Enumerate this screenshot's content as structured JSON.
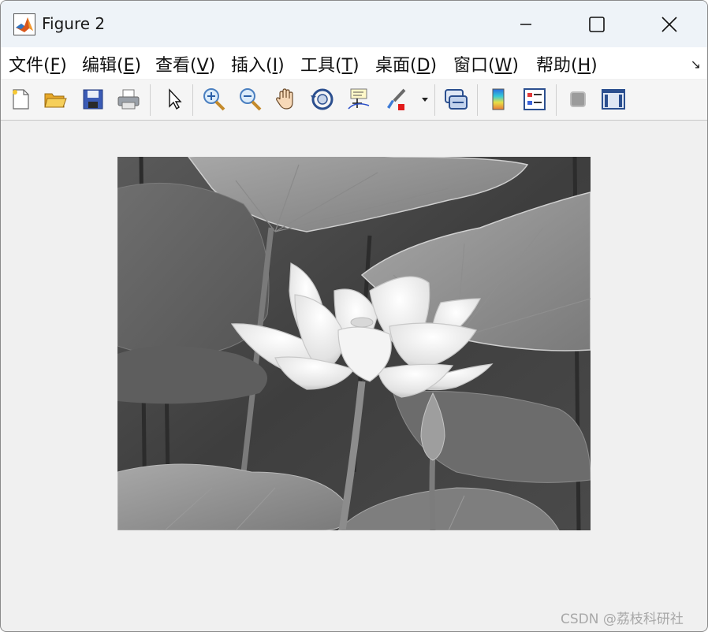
{
  "window": {
    "title": "Figure 2",
    "app_icon": "matlab-logo-icon"
  },
  "menubar": {
    "items": [
      {
        "label": "文件(",
        "key": "F",
        "end": ")"
      },
      {
        "label": "编辑(",
        "key": "E",
        "end": ")"
      },
      {
        "label": "查看(",
        "key": "V",
        "end": ")"
      },
      {
        "label": "插入(",
        "key": "I",
        "end": ")"
      },
      {
        "label": "工具(",
        "key": "T",
        "end": ")"
      },
      {
        "label": "桌面(",
        "key": "D",
        "end": ")"
      },
      {
        "label": "窗口(",
        "key": "W",
        "end": ")"
      },
      {
        "label": "帮助(",
        "key": "H",
        "end": ")"
      }
    ],
    "dock_icon": "dock-arrow-icon"
  },
  "toolbar": {
    "icons": [
      "new-figure-icon",
      "open-file-icon",
      "save-icon",
      "print-icon",
      "select-arrow-icon",
      "zoom-in-icon",
      "zoom-out-icon",
      "pan-hand-icon",
      "rotate-3d-icon",
      "data-cursor-icon",
      "brush-icon",
      "brush-dropdown-icon",
      "link-plot-icon",
      "colorbar-icon",
      "legend-icon",
      "hide-plot-tools-icon",
      "show-plot-tools-icon"
    ]
  },
  "figure": {
    "image_desc": "grayscale lotus flower"
  },
  "watermark": "CSDN @荔枝科研社"
}
